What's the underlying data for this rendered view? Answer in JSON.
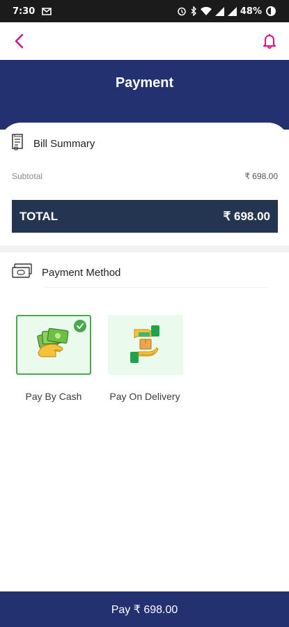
{
  "status_bar": {
    "time": "7:30",
    "battery": "48%"
  },
  "header": {
    "title": "Payment"
  },
  "bill_summary": {
    "title": "Bill Summary",
    "subtotal_label": "Subtotal",
    "subtotal_value": "₹ 698.00",
    "total_label": "TOTAL",
    "total_value": "₹ 698.00"
  },
  "payment_method": {
    "title": "Payment Method",
    "options": [
      {
        "label": "Pay By Cash",
        "selected": true
      },
      {
        "label": "Pay On Delivery",
        "selected": false
      }
    ]
  },
  "footer": {
    "pay_label": "Pay ₹ 698.00"
  },
  "colors": {
    "primary": "#243170",
    "total_bar": "#243551",
    "accent": "#d6147f",
    "success": "#47a84e"
  }
}
